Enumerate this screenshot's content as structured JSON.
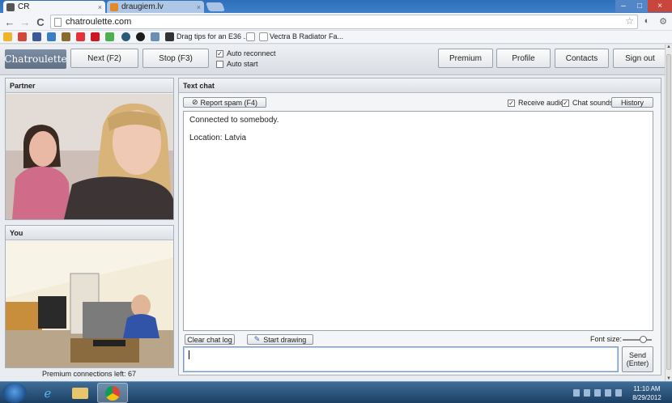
{
  "browser": {
    "tabs": [
      {
        "title": "CR",
        "close": "×"
      },
      {
        "title": "draugiem.lv",
        "close": "×"
      }
    ],
    "window_controls": {
      "minimize": "–",
      "maximize": "□",
      "close": "×"
    },
    "nav": {
      "back": "←",
      "forward": "→",
      "reload": "C"
    },
    "url": "chatroulette.com",
    "bookmarks": [
      {
        "text": "Drag tips for an E36 ..."
      },
      {
        "text": "Vectra B Radiator Fa..."
      }
    ]
  },
  "header": {
    "logo": "Chatroulette",
    "next_label": "Next (F2)",
    "stop_label": "Stop (F3)",
    "auto_reconnect_label": "Auto reconnect",
    "auto_reconnect_checked": true,
    "auto_start_label": "Auto start",
    "auto_start_checked": false,
    "premium_label": "Premium",
    "profile_label": "Profile",
    "contacts_label": "Contacts",
    "signout_label": "Sign out"
  },
  "partner": {
    "title": "Partner"
  },
  "you": {
    "title": "You"
  },
  "premium_connections": "Premium connections left: 67",
  "chat": {
    "title": "Text chat",
    "report_label": "Report spam (F4)",
    "receive_audio_label": "Receive audio",
    "chat_sounds_label": "Chat sounds",
    "history_label": "History",
    "messages": [
      "Connected to somebody.",
      "Location: Latvia"
    ],
    "clear_label": "Clear chat log",
    "draw_label": "Start drawing",
    "font_size_label": "Font size:",
    "font_size_level": 0.7,
    "send_label_1": "Send",
    "send_label_2": "(Enter)",
    "input_value": ""
  },
  "taskbar": {
    "time": "11:10 AM",
    "date": "8/29/2012"
  },
  "colors": {
    "titlebar": "#3d7fc9",
    "logo_bg": "#6b7c93",
    "taskbar": "#1c3f63"
  }
}
